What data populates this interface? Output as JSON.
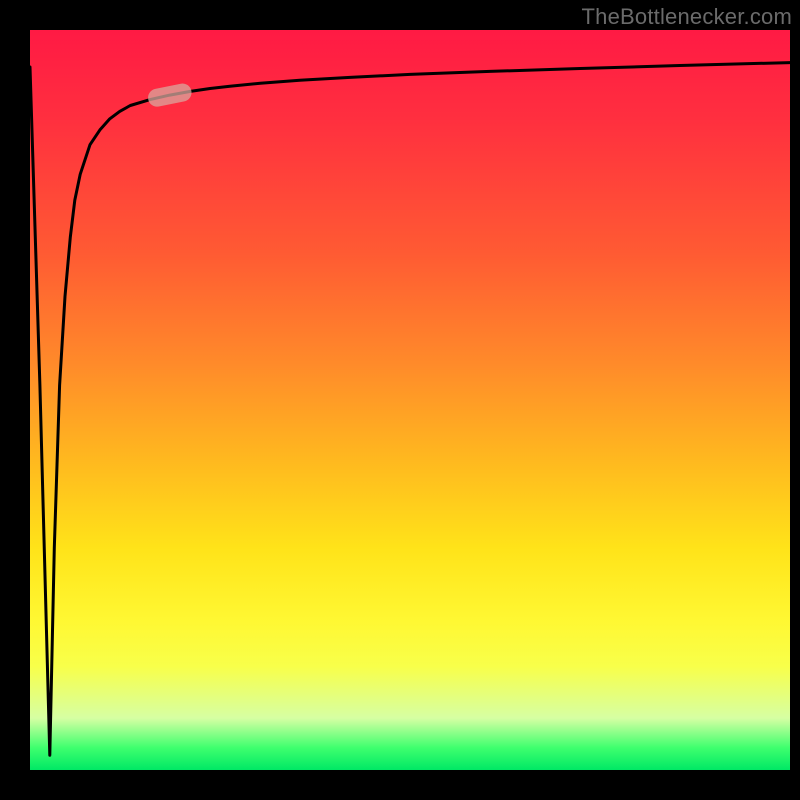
{
  "watermark": "TheBottlenecker.com",
  "chart_data": {
    "type": "line",
    "title": "",
    "xlabel": "",
    "ylabel": "",
    "xlim": [
      0,
      100
    ],
    "ylim": [
      0,
      100
    ],
    "grid": false,
    "series": [
      {
        "name": "bottleneck-curve",
        "x": [
          0.0,
          1.3,
          2.6,
          3.2,
          3.9,
          4.6,
          5.3,
          5.9,
          6.6,
          7.9,
          9.2,
          10.5,
          11.8,
          13.2,
          15.8,
          18.4,
          21.1,
          23.7,
          26.3,
          30.3,
          35.5,
          42.1,
          50.0,
          60.5,
          72.4,
          85.5,
          100.0
        ],
        "y": [
          95.0,
          52.0,
          2.0,
          30.0,
          52.0,
          64.0,
          72.0,
          77.0,
          80.5,
          84.5,
          86.5,
          88.0,
          89.0,
          89.8,
          90.6,
          91.2,
          91.7,
          92.1,
          92.4,
          92.8,
          93.2,
          93.6,
          94.0,
          94.4,
          94.8,
          95.2,
          95.6
        ]
      }
    ],
    "marker": {
      "series": "bottleneck-curve",
      "x": 18.4,
      "y": 91.2,
      "shape": "rounded-pill",
      "color": "#d9a79e"
    }
  }
}
